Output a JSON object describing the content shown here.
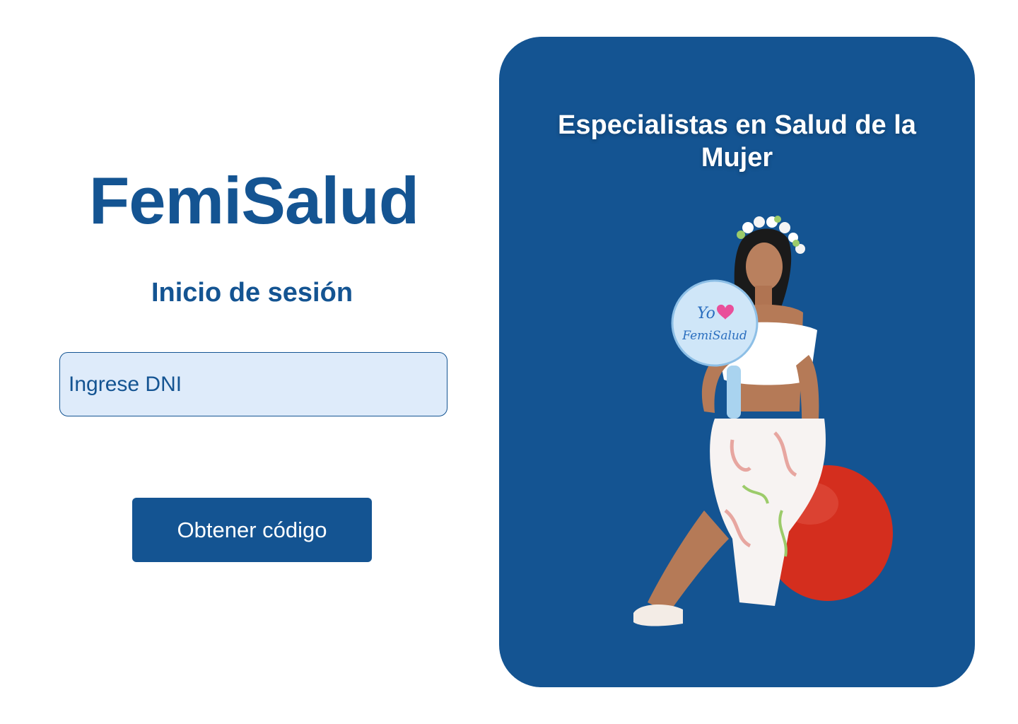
{
  "login": {
    "brand_name": "FemiSalud",
    "title": "Inicio de sesión",
    "dni_input": {
      "placeholder": "Ingrese DNI",
      "value": ""
    },
    "get_code_button": "Obtener código"
  },
  "promo": {
    "heading": "Especialistas en Salud de la Mujer",
    "sign_text_top": "Yo",
    "sign_text_bottom": "FemiSalud",
    "image_icon": "woman-on-exercise-ball-illustration"
  },
  "colors": {
    "brand_blue": "#145492",
    "input_background": "#deebfa",
    "ball_red": "#d42e1e",
    "white": "#ffffff",
    "heart_pink": "#e94f9a"
  }
}
